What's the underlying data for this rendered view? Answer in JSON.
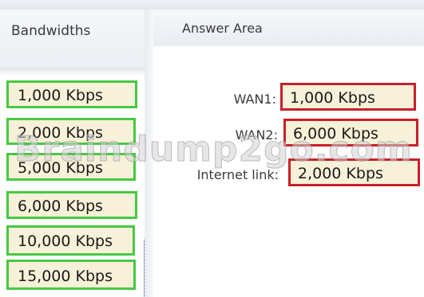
{
  "left_panel": {
    "title": "Bandwidths",
    "items": [
      {
        "label": "1,000 Kbps"
      },
      {
        "label": "2,000 Kbps"
      },
      {
        "label": "5,000 Kbps"
      },
      {
        "label": "6,000 Kbps"
      },
      {
        "label": "10,000 Kbps"
      },
      {
        "label": "15,000 Kbps"
      }
    ]
  },
  "answer_area": {
    "title": "Answer Area",
    "rows": [
      {
        "label": "WAN1:",
        "value": "1,000 Kbps"
      },
      {
        "label": "WAN2:",
        "value": "6,000 Kbps"
      },
      {
        "label": "Internet link:",
        "value": "2,000 Kbps"
      }
    ]
  },
  "watermark": "Braindump2go.com",
  "colors": {
    "item_border": "#46c940",
    "answer_border": "#c8202a",
    "box_fill": "#f6f1d8"
  }
}
